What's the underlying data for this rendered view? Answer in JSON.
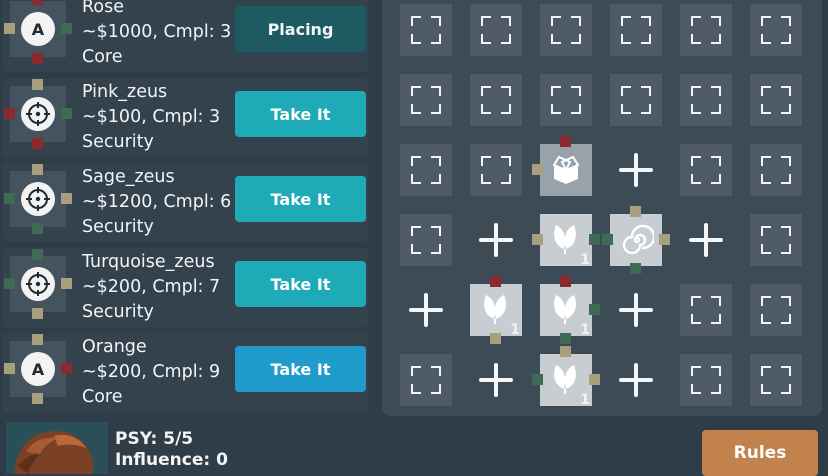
{
  "cards": [
    {
      "name": "Rose",
      "price_line": "~$1000, Cmpl: 3",
      "category": "Core",
      "button_label": "Placing",
      "badge": "A",
      "icon": "a-badge-icon"
    },
    {
      "name": "Pink_zeus",
      "price_line": "~$100, Cmpl: 3",
      "category": "Security",
      "button_label": "Take It",
      "badge": "",
      "icon": "target-icon"
    },
    {
      "name": "Sage_zeus",
      "price_line": "~$1200, Cmpl: 6",
      "category": "Security",
      "button_label": "Take It",
      "badge": "",
      "icon": "target-icon"
    },
    {
      "name": "Turquoise_zeus",
      "price_line": "~$200, Cmpl: 7",
      "category": "Security",
      "button_label": "Take It",
      "badge": "",
      "icon": "target-icon"
    },
    {
      "name": "Orange",
      "price_line": "~$200, Cmpl: 9",
      "category": "Core",
      "button_label": "Take It",
      "badge": "A",
      "icon": "a-badge-icon"
    }
  ],
  "grid": {
    "rows": 6,
    "cols": 6,
    "placed": [
      {
        "row": 2,
        "col": 2,
        "icon": "box-icon",
        "count": ""
      },
      {
        "row": 3,
        "col": 2,
        "icon": "leaf-icon",
        "count": "1"
      },
      {
        "row": 3,
        "col": 3,
        "icon": "spiral-icon",
        "count": ""
      },
      {
        "row": 4,
        "col": 1,
        "icon": "leaf-icon",
        "count": "1"
      },
      {
        "row": 4,
        "col": 2,
        "icon": "leaf-icon",
        "count": "1"
      },
      {
        "row": 5,
        "col": 2,
        "icon": "leaf-icon",
        "count": "1"
      }
    ],
    "plus_slots": [
      {
        "row": 2,
        "col": 3
      },
      {
        "row": 3,
        "col": 1
      },
      {
        "row": 3,
        "col": 4
      },
      {
        "row": 4,
        "col": 0
      },
      {
        "row": 4,
        "col": 3
      },
      {
        "row": 5,
        "col": 1
      },
      {
        "row": 5,
        "col": 3
      }
    ]
  },
  "player": {
    "psy": "PSY: 5/5",
    "influence": "Influence: 0"
  },
  "rules_label": "Rules",
  "colors": {
    "pin_sage": "#a89f7e",
    "pin_red": "#8a2a2e",
    "pin_green": "#3f6b55"
  }
}
